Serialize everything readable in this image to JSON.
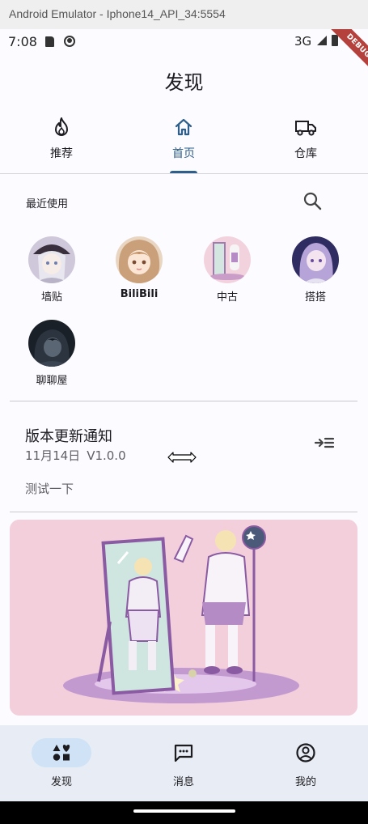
{
  "window": {
    "title": "Android Emulator - Iphone14_API_34:5554"
  },
  "status_bar": {
    "time": "7:08",
    "network": "3G"
  },
  "debug_banner": "DEBUG",
  "app_bar": {
    "title": "发现"
  },
  "tabs": [
    {
      "label": "推荐",
      "icon": "flame-icon"
    },
    {
      "label": "首页",
      "icon": "home-icon",
      "active": true
    },
    {
      "label": "仓库",
      "icon": "truck-icon"
    }
  ],
  "recent": {
    "label": "最近使用",
    "apps": [
      {
        "name": "墙贴"
      },
      {
        "name": "BiliBili"
      },
      {
        "name": "中古"
      },
      {
        "name": "搭搭"
      },
      {
        "name": "聊聊屋"
      }
    ]
  },
  "notice": {
    "title": "版本更新通知",
    "date": "11月14日",
    "version": "V1.0.0",
    "body": "测试一下"
  },
  "bottom_nav": [
    {
      "label": "发现",
      "icon": "discover-icon",
      "active": true
    },
    {
      "label": "消息",
      "icon": "message-icon"
    },
    {
      "label": "我的",
      "icon": "account-icon"
    }
  ],
  "colors": {
    "accent": "#2e5f8a",
    "nav_background": "#e8edf5",
    "nav_pill": "#cfe2f6",
    "banner_bg": "#f3cfdc"
  }
}
